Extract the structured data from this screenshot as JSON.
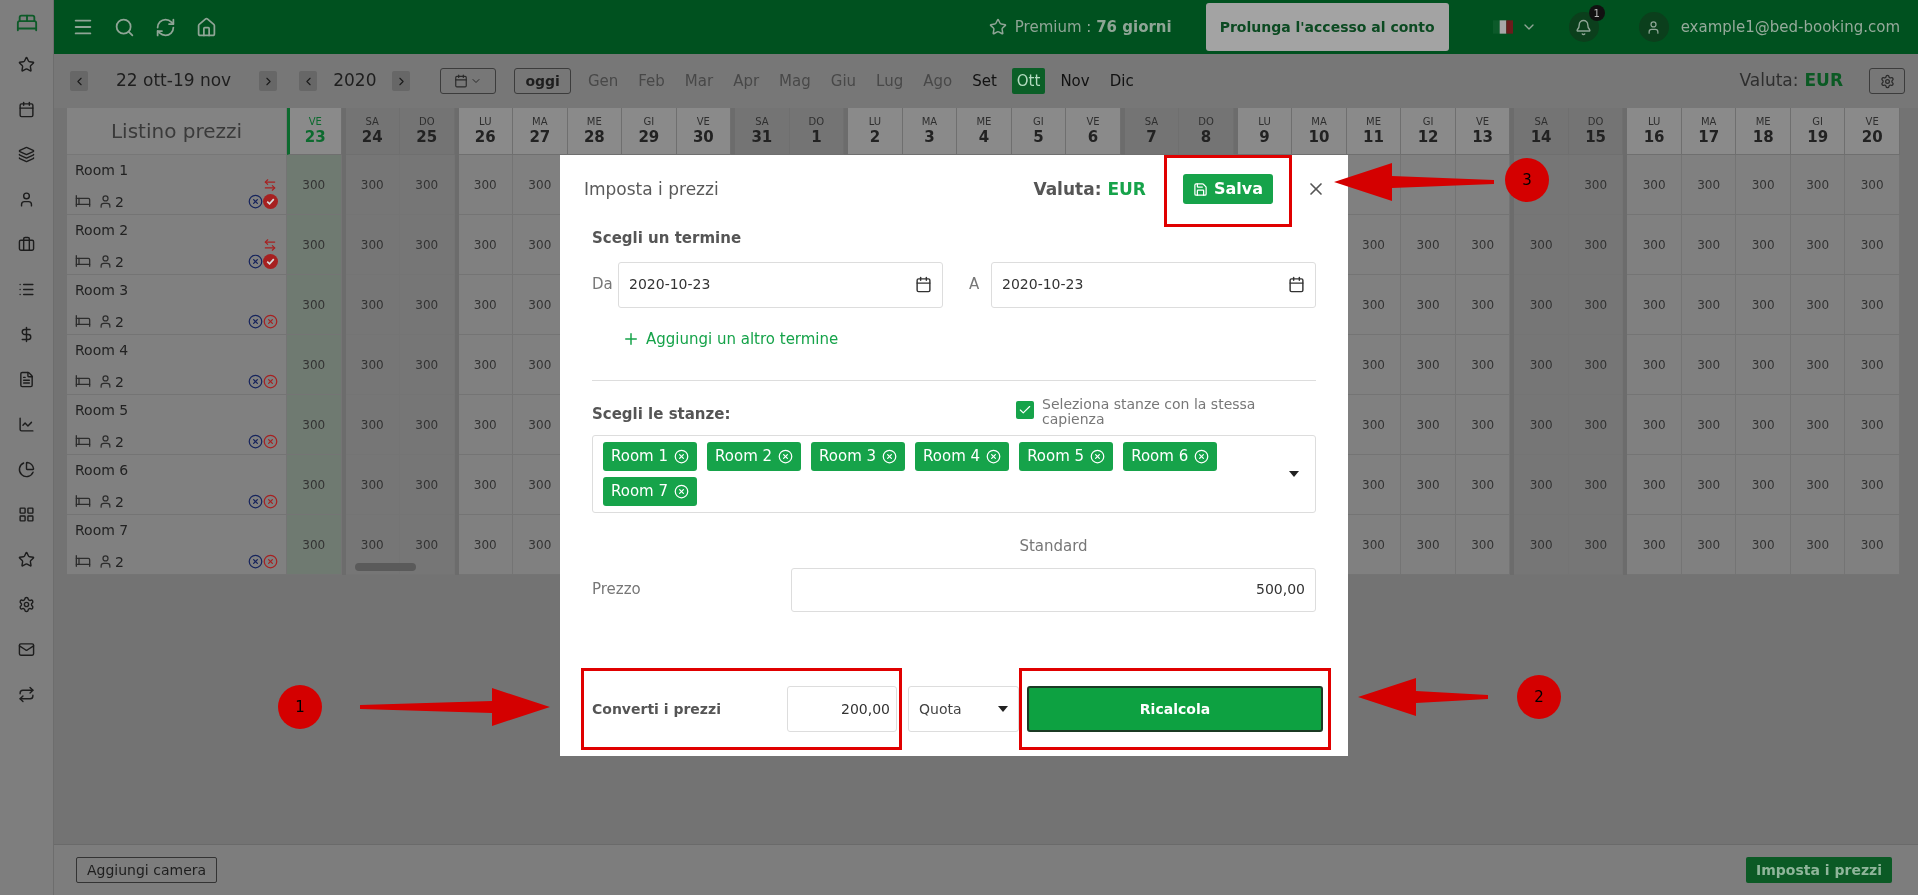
{
  "top_bar": {
    "premium": "Premium : **76 giorni**",
    "extend_button": "Prolunga l'accesso al conto",
    "notifications_badge": "1",
    "user_email": "example1@bed-booking.com"
  },
  "toolbar": {
    "date_range": "22 ott-19 nov",
    "year": "2020",
    "today_button": "oggi",
    "currency_label": "Valuta:",
    "currency": "EUR",
    "months": [
      {
        "label": "Gen",
        "disabled": true,
        "selected": false
      },
      {
        "label": "Feb",
        "disabled": true,
        "selected": false
      },
      {
        "label": "Mar",
        "disabled": true,
        "selected": false
      },
      {
        "label": "Apr",
        "disabled": true,
        "selected": false
      },
      {
        "label": "Mag",
        "disabled": true,
        "selected": false
      },
      {
        "label": "Giu",
        "disabled": true,
        "selected": false
      },
      {
        "label": "Lug",
        "disabled": true,
        "selected": false
      },
      {
        "label": "Ago",
        "disabled": true,
        "selected": false
      },
      {
        "label": "Set",
        "disabled": false,
        "selected": false
      },
      {
        "label": "Ott",
        "disabled": false,
        "selected": true
      },
      {
        "label": "Nov",
        "disabled": false,
        "selected": false
      },
      {
        "label": "Dic",
        "disabled": false,
        "selected": false
      }
    ]
  },
  "table": {
    "title": "Listino prezzi",
    "rooms": [
      {
        "name": "Room 1",
        "capacity": "2",
        "checked": true
      },
      {
        "name": "Room 2",
        "capacity": "2",
        "checked": true
      },
      {
        "name": "Room 3",
        "capacity": "2",
        "checked": false
      },
      {
        "name": "Room 4",
        "capacity": "2",
        "checked": false
      },
      {
        "name": "Room 5",
        "capacity": "2",
        "checked": false
      },
      {
        "name": "Room 6",
        "capacity": "2",
        "checked": false
      },
      {
        "name": "Room 7",
        "capacity": "2",
        "checked": false
      }
    ],
    "days": [
      {
        "dow": "VE",
        "day": "23",
        "selected": true,
        "weekend": false,
        "cells": [
          "300",
          "300",
          "300",
          "300",
          "300",
          "300",
          "300"
        ]
      },
      {
        "dow": "SA",
        "day": "24",
        "selected": false,
        "weekend": true,
        "cells": [
          "300",
          "300",
          "300",
          "300",
          "300",
          "300",
          "300"
        ]
      },
      {
        "dow": "DO",
        "day": "25",
        "selected": false,
        "weekend": true,
        "cells": [
          "300",
          "300",
          "300",
          "300",
          "300",
          "300",
          "300"
        ]
      },
      {
        "dow": "LU",
        "day": "26",
        "selected": false,
        "weekend": false,
        "cells": [
          "300",
          "300",
          "300",
          "300",
          "300",
          "300",
          "300"
        ]
      },
      {
        "dow": "MA",
        "day": "27",
        "selected": false,
        "weekend": false,
        "cells": [
          "300",
          "300",
          "300",
          "300",
          "300",
          "300",
          "300"
        ]
      },
      {
        "dow": "ME",
        "day": "28",
        "selected": false,
        "weekend": false
      },
      {
        "dow": "GI",
        "day": "29",
        "selected": false,
        "weekend": false
      },
      {
        "dow": "VE",
        "day": "30",
        "selected": false,
        "weekend": false
      },
      {
        "dow": "SA",
        "day": "31",
        "selected": false,
        "weekend": true
      },
      {
        "dow": "DO",
        "day": "1",
        "selected": false,
        "weekend": true
      },
      {
        "dow": "LU",
        "day": "2",
        "selected": false,
        "weekend": false
      },
      {
        "dow": "MA",
        "day": "3",
        "selected": false,
        "weekend": false
      },
      {
        "dow": "ME",
        "day": "4",
        "selected": false,
        "weekend": false
      },
      {
        "dow": "GI",
        "day": "5",
        "selected": false,
        "weekend": false
      },
      {
        "dow": "VE",
        "day": "6",
        "selected": false,
        "weekend": false
      },
      {
        "dow": "SA",
        "day": "7",
        "selected": false,
        "weekend": true
      },
      {
        "dow": "DO",
        "day": "8",
        "selected": false,
        "weekend": true
      },
      {
        "dow": "LU",
        "day": "9",
        "selected": false,
        "weekend": false
      },
      {
        "dow": "MA",
        "day": "10",
        "selected": false,
        "weekend": false
      },
      {
        "dow": "ME",
        "day": "11",
        "selected": false,
        "weekend": false,
        "cells": [
          null,
          "300",
          "300",
          "300",
          "300",
          "300",
          "300"
        ]
      },
      {
        "dow": "GI",
        "day": "12",
        "selected": false,
        "weekend": false,
        "cells": [
          null,
          "300",
          "300",
          "300",
          "300",
          "300",
          "300"
        ]
      },
      {
        "dow": "VE",
        "day": "13",
        "selected": false,
        "weekend": false,
        "cells": [
          null,
          "300",
          "300",
          "300",
          "300",
          "300",
          "300"
        ]
      },
      {
        "dow": "SA",
        "day": "14",
        "selected": false,
        "weekend": true,
        "cells": [
          null,
          "300",
          "300",
          "300",
          "300",
          "300",
          "300"
        ]
      },
      {
        "dow": "DO",
        "day": "15",
        "selected": false,
        "weekend": true,
        "cells": [
          "300",
          "300",
          "300",
          "300",
          "300",
          "300",
          "300"
        ]
      },
      {
        "dow": "LU",
        "day": "16",
        "selected": false,
        "weekend": false,
        "cells": [
          "300",
          "300",
          "300",
          "300",
          "300",
          "300",
          "300"
        ]
      },
      {
        "dow": "MA",
        "day": "17",
        "selected": false,
        "weekend": false,
        "cells": [
          "300",
          "300",
          "300",
          "300",
          "300",
          "300",
          "300"
        ]
      },
      {
        "dow": "ME",
        "day": "18",
        "selected": false,
        "weekend": false,
        "cells": [
          "300",
          "300",
          "300",
          "300",
          "300",
          "300",
          "300"
        ]
      },
      {
        "dow": "GI",
        "day": "19",
        "selected": false,
        "weekend": false,
        "cells": [
          "300",
          "300",
          "300",
          "300",
          "300",
          "300",
          "300"
        ]
      },
      {
        "dow": "VE",
        "day": "20",
        "selected": false,
        "weekend": false,
        "cells": [
          "300",
          "300",
          "300",
          "300",
          "300",
          "300",
          "300"
        ]
      }
    ]
  },
  "footer": {
    "add_room_button": "Aggiungi camera",
    "set_prices_button": "Imposta i prezzi"
  },
  "dialog": {
    "title": "Imposta i prezzi",
    "currency_label": "Valuta:",
    "currency": "EUR",
    "save_button": "Salva",
    "period_heading": "Scegli un termine",
    "from_label": "Da",
    "from_value": "2020-10-23",
    "to_label": "A",
    "to_value": "2020-10-23",
    "add_period_link": "Aggiungi un altro termine",
    "rooms_heading": "Scegli le stanze:",
    "same_capacity": {
      "label": "Seleziona stanze con la stessa capienza",
      "checked": true
    },
    "room_tags": [
      "Room 1",
      "Room 2",
      "Room 3",
      "Room 4",
      "Room 5",
      "Room 6",
      "Room 7"
    ],
    "price_column": "Standard",
    "price_label": "Prezzo",
    "price_value": "500,00",
    "convert_label": "Converti i prezzi",
    "convert_value": "200,00",
    "convert_mode": "Quota",
    "recalculate_button": "Ricalcola"
  },
  "annotations": [
    {
      "label": "1"
    },
    {
      "label": "2"
    },
    {
      "label": "3"
    }
  ]
}
